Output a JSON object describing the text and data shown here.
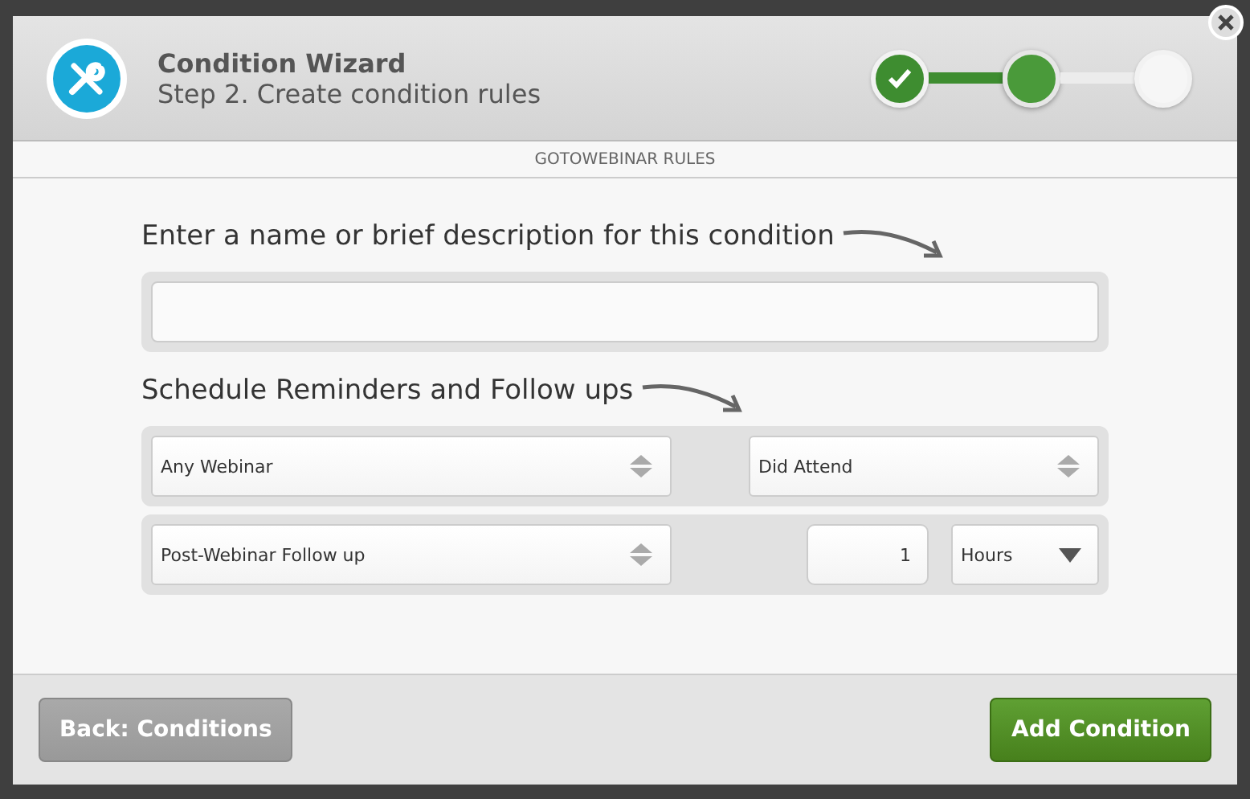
{
  "wizard": {
    "title": "Condition Wizard",
    "subtitle": "Step 2. Create condition rules",
    "steps": [
      {
        "completed": true,
        "selected": false
      },
      {
        "completed": false,
        "selected": true
      },
      {
        "completed": false,
        "selected": false
      }
    ]
  },
  "section_label": "GOTOWEBINAR RULES",
  "name_prompt": "Enter a name or brief description for this condition",
  "schedule_prompt": "Schedule Reminders and Follow ups",
  "rows": [
    [
      {
        "kind": "select",
        "value": "Any Webinar",
        "wide": true
      },
      {
        "kind": "select",
        "value": "Did Attend",
        "wide": false
      }
    ],
    [
      {
        "kind": "select",
        "value": "Post-Webinar Follow up",
        "wide": true
      },
      {
        "kind": "number",
        "value": "1"
      },
      {
        "kind": "dropdown",
        "value": "Hours"
      }
    ]
  ],
  "buttons": {
    "back": "Back: Conditions",
    "primary": "Add Condition"
  }
}
